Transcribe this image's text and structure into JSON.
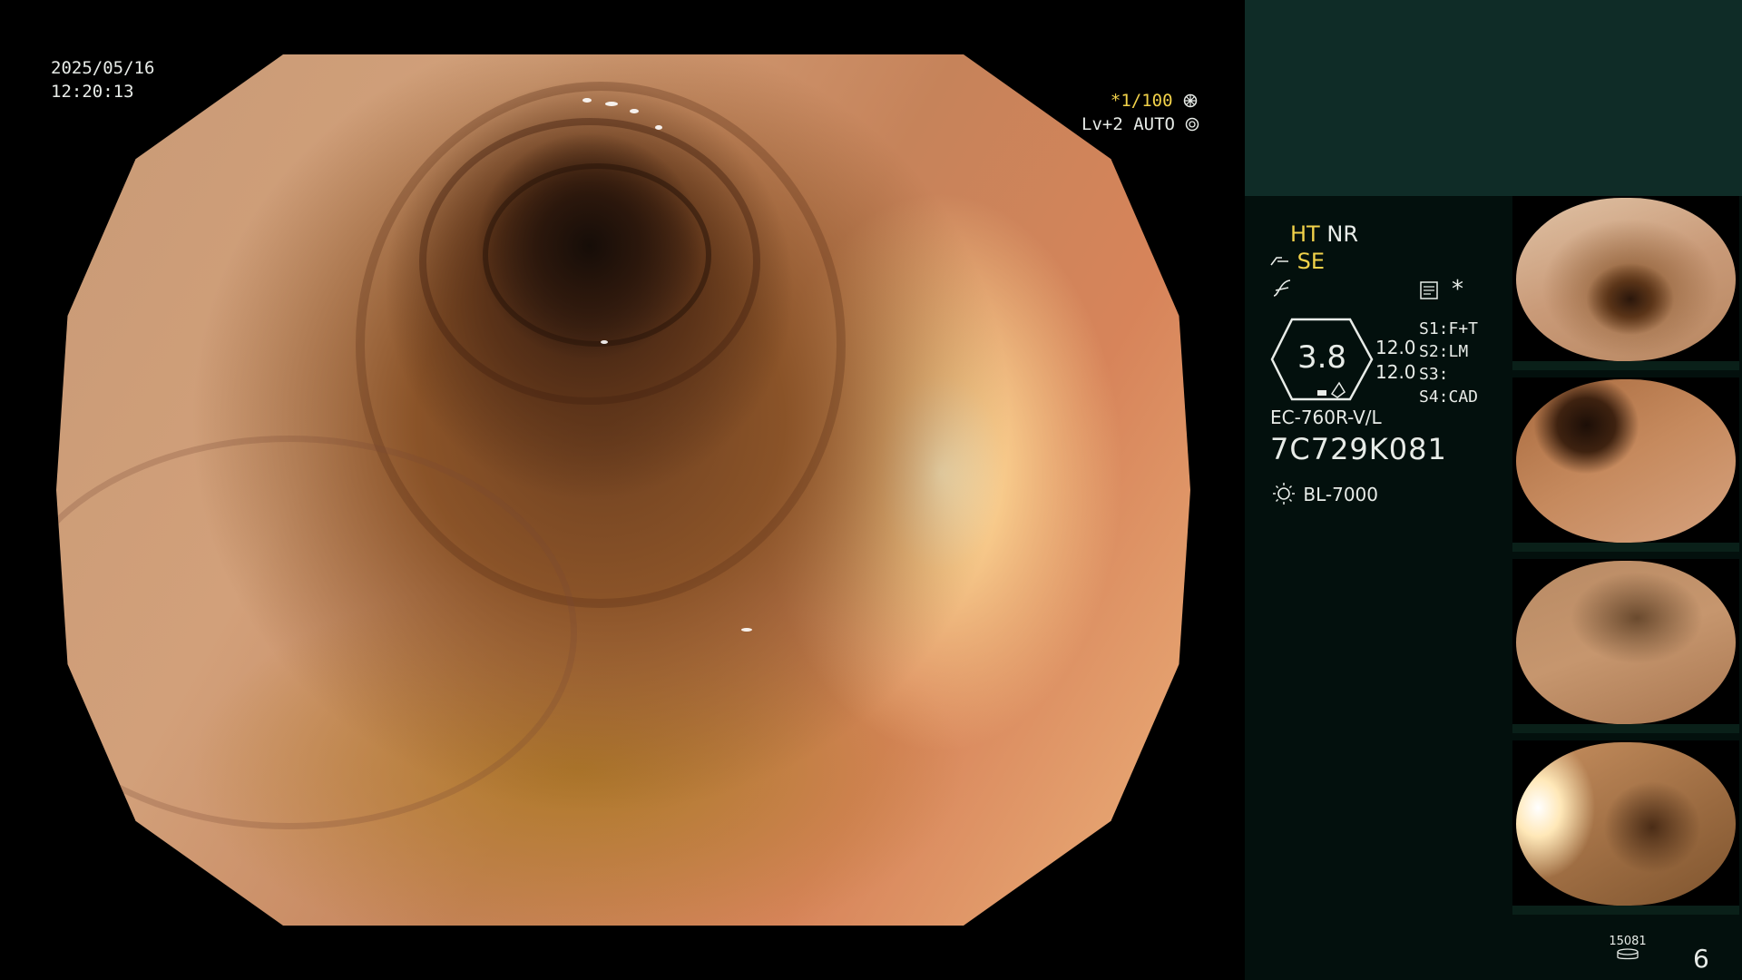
{
  "overlay": {
    "date": "2025/05/16",
    "time": "12:20:13",
    "shutter": "*1/100",
    "level": "Lv+2",
    "mode": "AUTO"
  },
  "panel": {
    "ht": "HT",
    "nr": "NR",
    "se": "SE",
    "star": "*",
    "zoom_value": "3.8",
    "params": [
      "12.0",
      "12.0"
    ],
    "settings": [
      "S1:F+T",
      "S2:LM",
      "S3:",
      "S4:CAD"
    ],
    "scope_model": "EC-760R-V/L",
    "serial": "7C729K081",
    "light_source": "BL-7000",
    "bottom_code": "15081",
    "image_count": "6"
  },
  "icons": {
    "shutter": "gear-wheel-icon",
    "mode": "iris-icon",
    "se": "ramp-enhance-icon",
    "curve": "tone-curve-icon",
    "memo": "document-list-icon",
    "light": "lamp-sun-icon",
    "storage": "disk-stack-icon"
  },
  "colors": {
    "panel_bg": "#03100d",
    "panel_top": "#0f2c27",
    "accent_yellow": "#f2d24a",
    "text": "#e8ece8"
  }
}
